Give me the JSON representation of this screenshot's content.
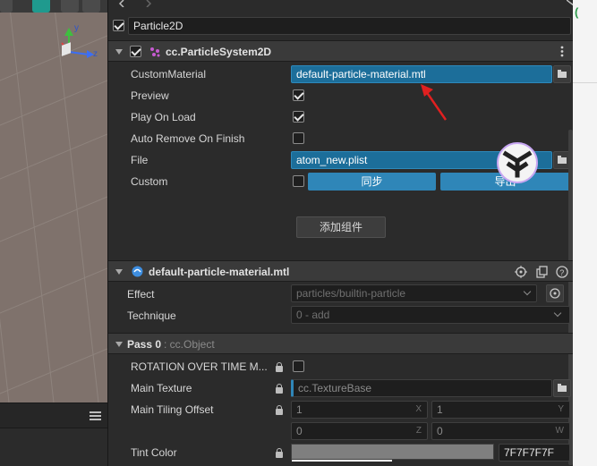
{
  "scene": {
    "axis_y": "y",
    "axis_z": "z",
    "menu_icon": "hamburger-icon"
  },
  "inspector": {
    "node_name": "Particle2D",
    "component": {
      "title": "cc.ParticleSystem2D",
      "rows": {
        "custom_material": {
          "label": "CustomMaterial",
          "value": "default-particle-material.mtl"
        },
        "preview": {
          "label": "Preview",
          "checked": true
        },
        "play_on_load": {
          "label": "Play On Load",
          "checked": true
        },
        "auto_remove": {
          "label": "Auto Remove On Finish",
          "checked": false
        },
        "file": {
          "label": "File",
          "value": "atom_new.plist"
        },
        "custom": {
          "label": "Custom",
          "checked": false,
          "sync_button": "同步",
          "export_button": "导出"
        }
      }
    },
    "add_component_button": "添加组件",
    "material": {
      "title": "default-particle-material.mtl",
      "effect": {
        "label": "Effect",
        "value": "particles/builtin-particle"
      },
      "technique": {
        "label": "Technique",
        "value": "0 - add"
      }
    },
    "pass": {
      "title": "Pass 0",
      "type": ": cc.Object",
      "rotation": {
        "label": "ROTATION OVER TIME M..."
      },
      "main_texture": {
        "label": "Main Texture",
        "value": "cc.TextureBase"
      },
      "main_tiling_offset": {
        "label": "Main Tiling Offset",
        "x": "1",
        "y": "1",
        "z": "0",
        "w": "0",
        "x_label": "X",
        "y_label": "Y",
        "z_label": "Z",
        "w_label": "W"
      },
      "tint_color": {
        "label": "Tint Color",
        "hex": "7F7F7F7F",
        "swatch": "#7f7f7f"
      }
    }
  },
  "colors": {
    "accent": "#2f86b8",
    "field_blue": "#1c6e9a",
    "annotation_arrow": "#e02020"
  }
}
